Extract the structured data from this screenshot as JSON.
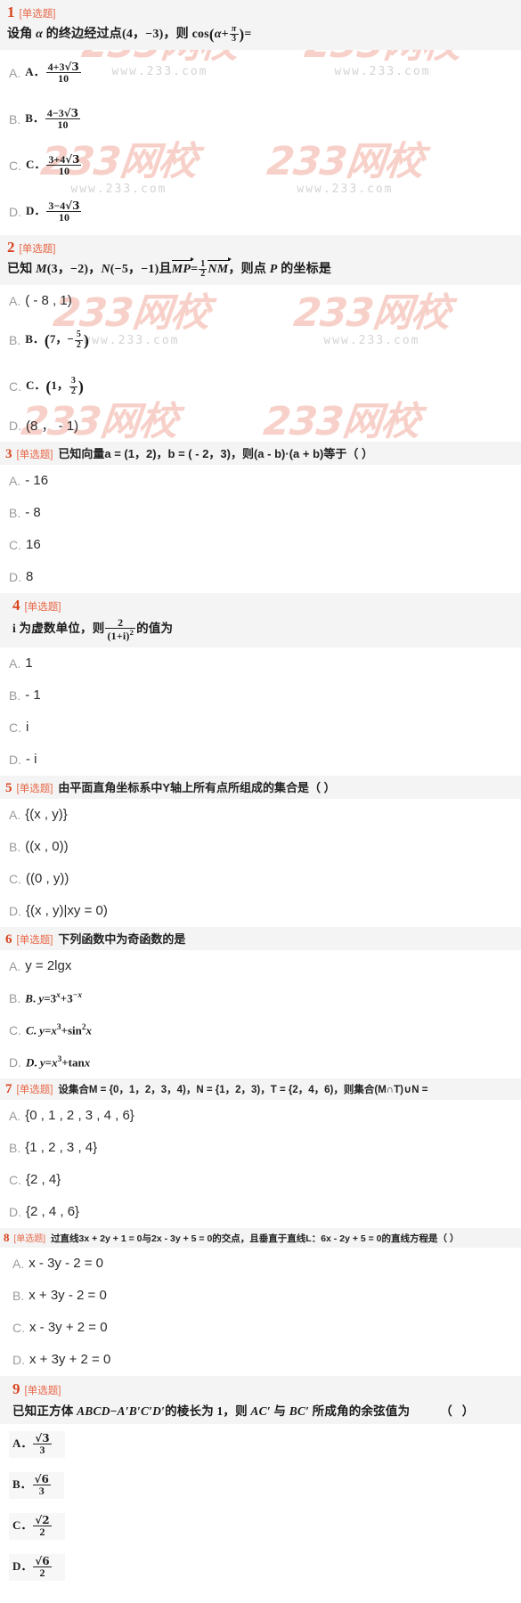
{
  "site": {
    "watermark_main": "233网校",
    "watermark_sub": "www.233.com",
    "watermark_color": "#f6c9c0",
    "accent_color": "#d9441f",
    "type_color": "#e8694a",
    "header_bg": "#f4f4f4"
  },
  "questions": [
    {
      "number": "1",
      "type": "[单选题]",
      "stem_plain": "设角 α 的终边经过点(4，−3)，则 cos(α+π/3) =",
      "options": [
        {
          "label": "A.",
          "text": "A. (4+3√3)/10"
        },
        {
          "label": "B.",
          "text": "B. (4−3√3)/10"
        },
        {
          "label": "C.",
          "text": "C. (3+4√3)/10"
        },
        {
          "label": "D.",
          "text": "D. (3−4√3)/10"
        }
      ]
    },
    {
      "number": "2",
      "type": "[单选题]",
      "stem_plain": "已知 M(3，−2)，N(−5，−1)且 MP = 1/2 NM，则点 P 的坐标是",
      "options": [
        {
          "label": "A.",
          "text": "( - 8 , 1)"
        },
        {
          "label": "B.",
          "text": "B. (7，−5/2)"
        },
        {
          "label": "C.",
          "text": "C. (1，3/2)"
        },
        {
          "label": "D.",
          "text": "(8 ，  - 1)"
        }
      ]
    },
    {
      "number": "3",
      "type": "[单选题]",
      "stem_plain": "已知向量a = (1，2)，b = ( - 2，3)，则(a - b)·(a + b)等于（        ）",
      "options": [
        {
          "label": "A.",
          "text": "- 16"
        },
        {
          "label": "B.",
          "text": "- 8"
        },
        {
          "label": "C.",
          "text": "16"
        },
        {
          "label": "D.",
          "text": "8"
        }
      ]
    },
    {
      "number": "4",
      "type": "[单选题]",
      "stem_plain": "i 为虚数单位，则 2/(1+i)² 的值为",
      "options": [
        {
          "label": "A.",
          "text": "1"
        },
        {
          "label": "B.",
          "text": "- 1"
        },
        {
          "label": "C.",
          "text": "i"
        },
        {
          "label": "D.",
          "text": "- i"
        }
      ]
    },
    {
      "number": "5",
      "type": "[单选题]",
      "stem_plain": "由平面直角坐标系中Y轴上所有点所组成的集合是（        ）",
      "options": [
        {
          "label": "A.",
          "text": "{(x , y)}"
        },
        {
          "label": "B.",
          "text": "((x , 0))"
        },
        {
          "label": "C.",
          "text": "((0 , y))"
        },
        {
          "label": "D.",
          "text": "{(x , y)|xy = 0)"
        }
      ]
    },
    {
      "number": "6",
      "type": "[单选题]",
      "stem_plain": "下列函数中为奇函数的是",
      "options": [
        {
          "label": "A.",
          "text": "y = 2lgx"
        },
        {
          "label": "B.",
          "text": "B. y=3ˣ+3⁻ˣ"
        },
        {
          "label": "C.",
          "text": "C. y=x³+sin²x"
        },
        {
          "label": "D.",
          "text": "D. y=x³+tanx"
        }
      ]
    },
    {
      "number": "7",
      "type": "[单选题]",
      "stem_plain": "设集合M = {0，1，2，3，4)，N = {1，2，3)，T = {2，4，6)，则集合(M∩T)∪N =",
      "options": [
        {
          "label": "A.",
          "text": "{0 , 1 , 2 , 3 , 4 , 6}"
        },
        {
          "label": "B.",
          "text": "{1 , 2 , 3 , 4}"
        },
        {
          "label": "C.",
          "text": "{2 , 4}"
        },
        {
          "label": "D.",
          "text": "{2 , 4 , 6}"
        }
      ]
    },
    {
      "number": "8",
      "type": "[单选题]",
      "stem_plain": "过直线3x + 2y + 1 = 0与2x - 3y + 5 = 0的交点，且垂直于直线L：6x - 2y + 5 = 0的直线方程是（      ）",
      "options": [
        {
          "label": "A.",
          "text": "x - 3y - 2 = 0"
        },
        {
          "label": "B.",
          "text": "x + 3y - 2 = 0"
        },
        {
          "label": "C.",
          "text": "x - 3y + 2 = 0"
        },
        {
          "label": "D.",
          "text": "x + 3y + 2 = 0"
        }
      ]
    },
    {
      "number": "9",
      "type": "[单选题]",
      "stem_plain": "已知正方体 ABCD−A′B′C′D′的棱长为 1，则 AC′ 与 BC′ 所成角的余弦值为        （    ）",
      "options": [
        {
          "label": "A.",
          "text": "A. √3/3"
        },
        {
          "label": "B.",
          "text": "B. √6/3"
        },
        {
          "label": "C.",
          "text": "C. √2/2"
        },
        {
          "label": "D.",
          "text": "D. √6/2"
        }
      ]
    }
  ],
  "labels": {
    "A": "A.",
    "B": "B.",
    "C": "C.",
    "D": "D."
  }
}
